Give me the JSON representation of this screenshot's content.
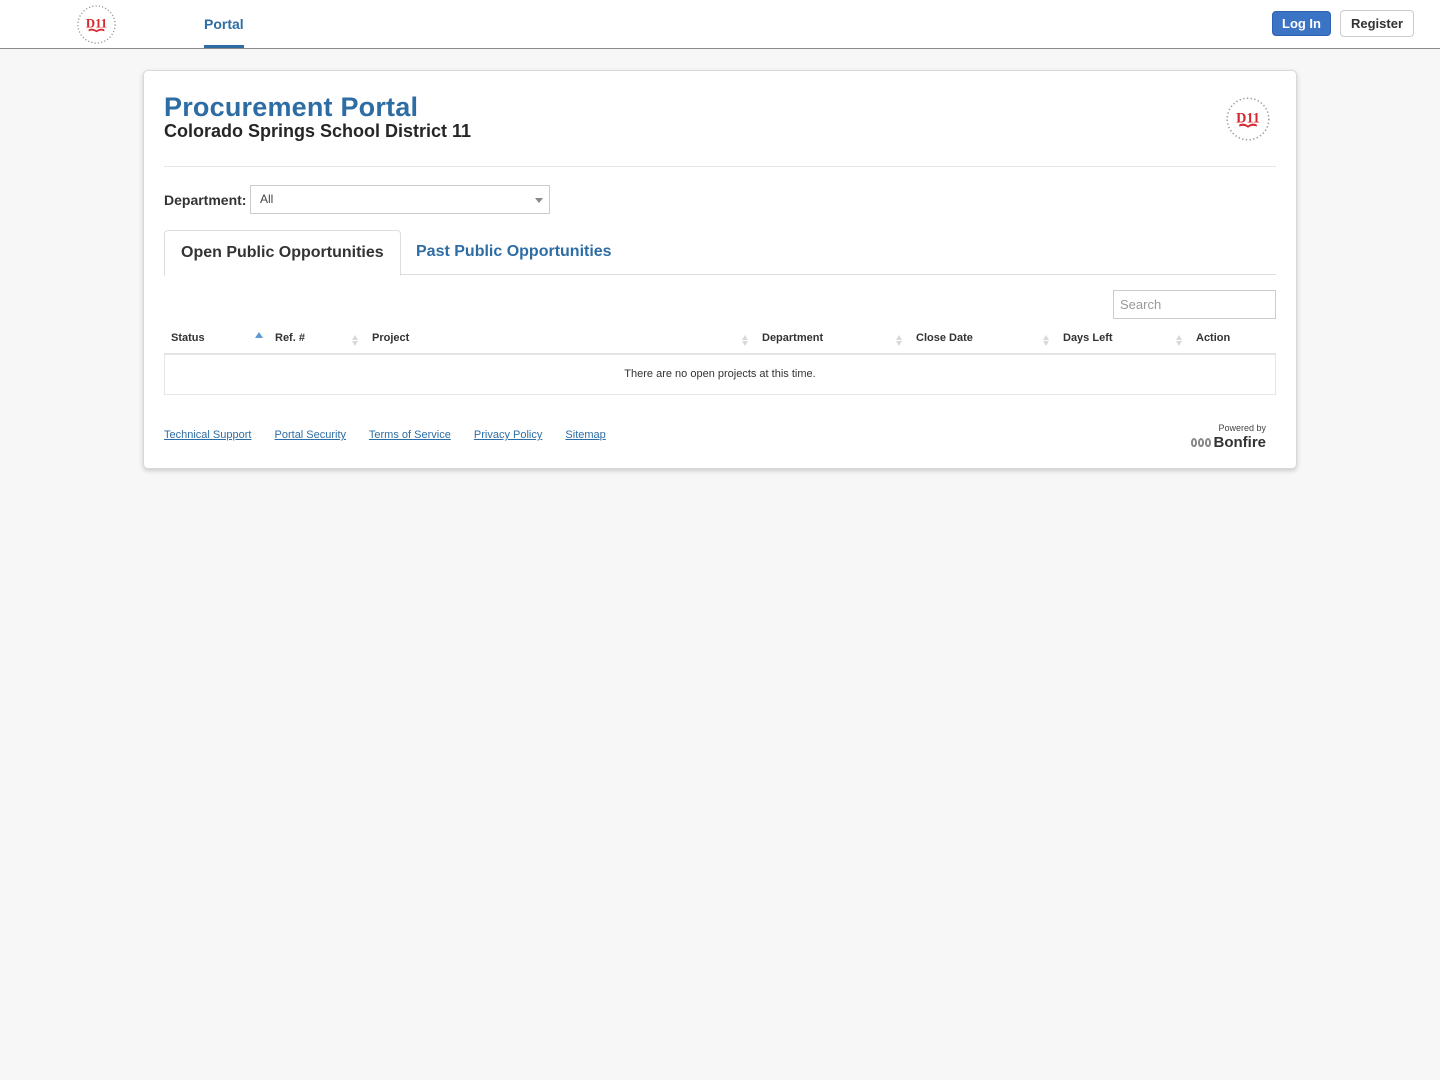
{
  "nav": {
    "logo_alt": "D11 Colorado Springs Schools",
    "portal_label": "Portal",
    "login_label": "Log In",
    "register_label": "Register"
  },
  "header": {
    "title": "Procurement Portal",
    "subtitle": "Colorado Springs School District 11"
  },
  "filter": {
    "department_label": "Department:",
    "department_value": "All"
  },
  "tabs": [
    {
      "label": "Open Public Opportunities",
      "active": true
    },
    {
      "label": "Past Public Opportunities",
      "active": false
    }
  ],
  "search": {
    "placeholder": "Search",
    "value": ""
  },
  "table": {
    "columns": [
      {
        "label": "Status",
        "sort": "asc"
      },
      {
        "label": "Ref. #",
        "sort": "none"
      },
      {
        "label": "Project",
        "sort": "none"
      },
      {
        "label": "Department",
        "sort": "none"
      },
      {
        "label": "Close Date",
        "sort": "none"
      },
      {
        "label": "Days Left",
        "sort": "none"
      },
      {
        "label": "Action",
        "sort": "none"
      }
    ],
    "rows": [],
    "empty_message": "There are no open projects at this time."
  },
  "footer": {
    "links": [
      "Technical Support",
      "Portal Security",
      "Terms of Service",
      "Privacy Policy",
      "Sitemap"
    ],
    "powered_by": "Powered by",
    "brand": "Bonfire"
  },
  "colors": {
    "brand_blue": "#2e6da4",
    "login_button": "#3b73c5",
    "logo_red": "#d7262e"
  }
}
